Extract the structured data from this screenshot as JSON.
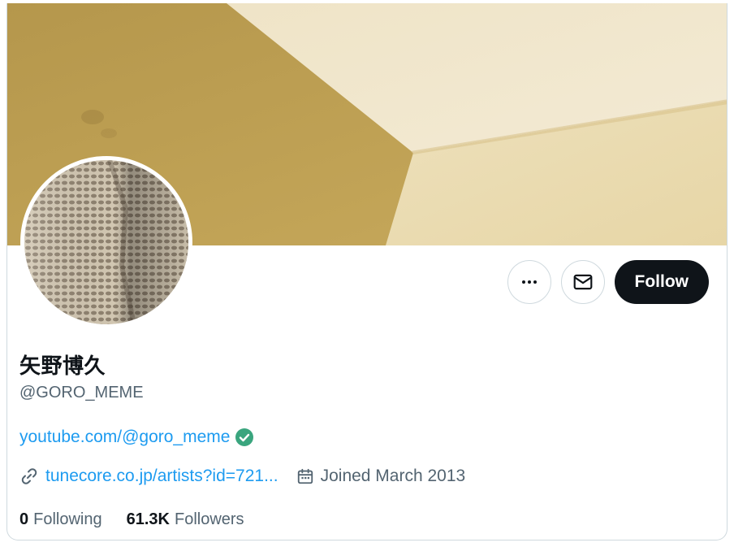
{
  "profile": {
    "display_name": "矢野博久",
    "handle": "@GORO_MEME",
    "bio_link": "youtube.com/@goro_meme",
    "website": "tunecore.co.jp/artists?id=721...",
    "joined": "Joined March 2013"
  },
  "actions": {
    "more_icon": "more-icon",
    "message_icon": "mail-icon",
    "follow_label": "Follow"
  },
  "stats": {
    "following_count": "0",
    "following_label": "Following",
    "followers_count": "61.3K",
    "followers_label": "Followers"
  },
  "colors": {
    "accent_link": "#1d9bf0",
    "verified_badge": "#3aa57e",
    "follow_button": "#0f1419",
    "secondary_text": "#536471"
  }
}
